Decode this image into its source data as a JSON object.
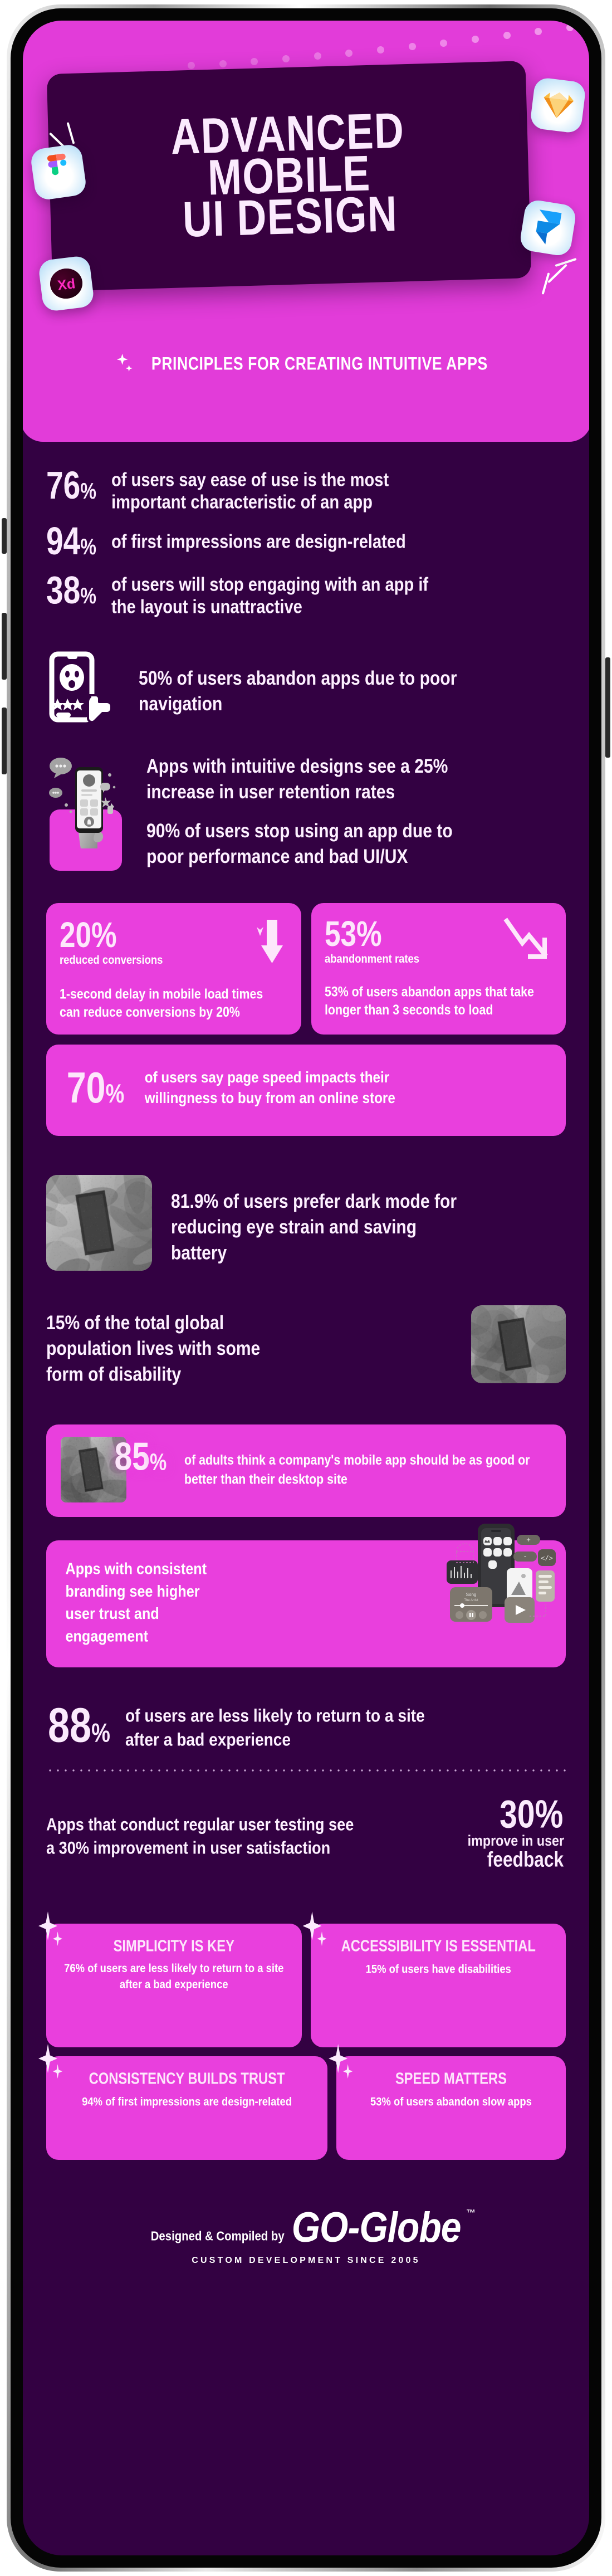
{
  "hero": {
    "title_lines": [
      "ADVANCED",
      "MOBILE",
      "UI DESIGN"
    ],
    "subtitle": "PRINCIPLES FOR CREATING INTUITIVE APPS",
    "app_icons": [
      {
        "name": "sketch-icon",
        "label": "Sketch"
      },
      {
        "name": "figma-icon",
        "label": "Figma"
      },
      {
        "name": "framer-icon",
        "label": "Framer"
      },
      {
        "name": "adobe-xd-icon",
        "label": "Xd"
      }
    ]
  },
  "stats": [
    {
      "pct": "76",
      "unit": "%",
      "text": "of users say ease of use is the most important characteristic of an app"
    },
    {
      "pct": "94",
      "unit": "%",
      "text": "of first impressions are design-related"
    },
    {
      "pct": "38",
      "unit": "%",
      "text": "of users will stop engaging with an app if the layout is unattractive"
    }
  ],
  "nav_block": {
    "icon": "phone-thumbs-down-icon",
    "text": "50% of users abandon apps due to poor navigation"
  },
  "retention_block": {
    "icon": "hand-holding-phone-illustration",
    "line1": "Apps with intuitive designs see a 25% increase in user retention rates",
    "line2": "90% of users stop using an app due to poor performance and bad UI/UX"
  },
  "dual_cards": [
    {
      "pct": "20%",
      "sub": "reduced conversions",
      "icon": "down-arrow-icon",
      "body": "1-second delay in mobile load times can reduce conversions by 20%"
    },
    {
      "pct": "53%",
      "sub": "abandonment rates",
      "icon": "declining-trend-icon",
      "body": "53% of users abandon apps that take longer than 3 seconds to load"
    }
  ],
  "speed_card": {
    "pct": "70",
    "unit": "%",
    "text": "of users say page speed impacts their willingness to buy from an online store"
  },
  "dark_mode": {
    "photo": "hand-holding-phone-dark-mode-photo",
    "text": "81.9% of users prefer dark mode for reducing eye strain and saving battery"
  },
  "disability": {
    "photo": "person-with-glasses-using-tablet-photo",
    "text": "15% of the total global population lives with some form of disability"
  },
  "mobile_app_card": {
    "photo": "hands-holding-phone-ui-photo",
    "pct": "85",
    "unit": "%",
    "text": "of adults think a company's mobile app should be as good or better than their desktop site"
  },
  "branding_card": {
    "text": "Apps with consistent branding see higher user trust and engagement",
    "illustration": "floating-ui-components-illustration"
  },
  "return_stat": {
    "pct": "88",
    "unit": "%",
    "text": "of users are less likely to return to a site after a bad experience"
  },
  "testing_block": {
    "text": "Apps that conduct regular user testing see a 30% improvement in user satisfaction",
    "pct": "30%",
    "sub_line1": "improve in user",
    "sub_line2": "feedback"
  },
  "takeaways": [
    {
      "title": "SIMPLICITY IS KEY",
      "body": "76% of users are less likely to return to a site after a bad experience"
    },
    {
      "title": "ACCESSIBILITY IS ESSENTIAL",
      "body": "15% of users have disabilities"
    },
    {
      "title": "CONSISTENCY BUILDS TRUST",
      "body": "94% of first impressions are design-related"
    },
    {
      "title": "SPEED MATTERS",
      "body": "53% of users abandon slow apps"
    }
  ],
  "footer": {
    "credit": "Designed & Compiled by",
    "logo": "GO-Globe",
    "tm": "™",
    "tagline": "CUSTOM DEVELOPMENT SINCE 2005"
  },
  "colors": {
    "screen_bg": "#330142",
    "magenta": "#e23cd9",
    "card_pink": "#e93fdd",
    "hero_card": "#37003f",
    "text_light": "#fbeafd",
    "white": "#ffffff"
  }
}
